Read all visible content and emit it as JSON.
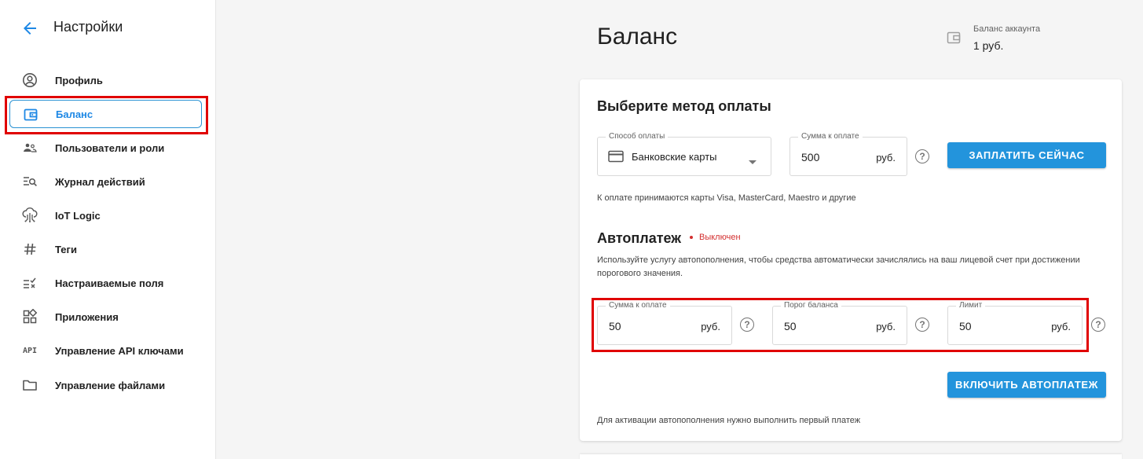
{
  "sidebar": {
    "title": "Настройки",
    "items": [
      {
        "label": "Профиль",
        "icon": "profile-icon"
      },
      {
        "label": "Баланс",
        "icon": "wallet-icon",
        "active": true
      },
      {
        "label": "Пользователи и роли",
        "icon": "users-icon"
      },
      {
        "label": "Журнал действий",
        "icon": "journal-search-icon"
      },
      {
        "label": "IoT Logic",
        "icon": "iot-logic-icon"
      },
      {
        "label": "Теги",
        "icon": "hashtag-icon"
      },
      {
        "label": "Настраиваемые поля",
        "icon": "custom-fields-icon"
      },
      {
        "label": "Приложения",
        "icon": "apps-icon"
      },
      {
        "label": "Управление API ключами",
        "icon": "api-icon",
        "icon_text": "API"
      },
      {
        "label": "Управление файлами",
        "icon": "folder-icon"
      }
    ]
  },
  "header": {
    "title": "Баланс",
    "balance_label": "Баланс аккаунта",
    "balance_value": "1 руб."
  },
  "payment": {
    "heading": "Выберите метод оплаты",
    "method_label": "Способ оплаты",
    "method_value": "Банковские карты",
    "amount_label": "Сумма к оплате",
    "amount_value": "500",
    "amount_unit": "руб.",
    "pay_button": "ЗАПЛАТИТЬ СЕЙЧАС",
    "note": "К оплате принимаются карты Visa, MasterCard, Maestro и другие"
  },
  "autopay": {
    "heading": "Автоплатеж",
    "status": "Выключен",
    "description_line1": "Используйте услугу автопополнения, чтобы средства автоматически зачислялись на ваш лицевой счет при достижении",
    "description_line2": "порогового значения.",
    "fields": [
      {
        "label": "Сумма к оплате",
        "value": "50",
        "unit": "руб."
      },
      {
        "label": "Порог баланса",
        "value": "50",
        "unit": "руб."
      },
      {
        "label": "Лимит",
        "value": "50",
        "unit": "руб."
      }
    ],
    "enable_button": "ВКЛЮЧИТЬ АВТОПЛАТЕЖ",
    "footnote": "Для активации автопополнения нужно выполнить первый платеж"
  },
  "colors": {
    "accent": "#2394dc",
    "highlight": "#e00000",
    "status_off": "#d32f2f"
  }
}
